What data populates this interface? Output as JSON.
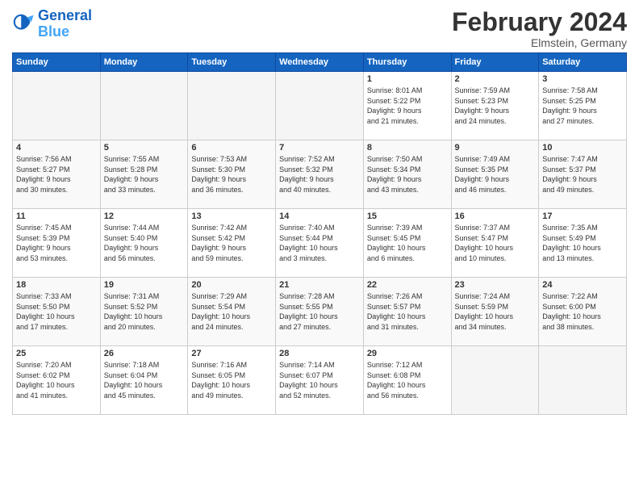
{
  "logo": {
    "line1": "General",
    "line2": "Blue"
  },
  "title": "February 2024",
  "location": "Elmstein, Germany",
  "days_of_week": [
    "Sunday",
    "Monday",
    "Tuesday",
    "Wednesday",
    "Thursday",
    "Friday",
    "Saturday"
  ],
  "weeks": [
    [
      {
        "day": "",
        "info": ""
      },
      {
        "day": "",
        "info": ""
      },
      {
        "day": "",
        "info": ""
      },
      {
        "day": "",
        "info": ""
      },
      {
        "day": "1",
        "info": "Sunrise: 8:01 AM\nSunset: 5:22 PM\nDaylight: 9 hours\nand 21 minutes."
      },
      {
        "day": "2",
        "info": "Sunrise: 7:59 AM\nSunset: 5:23 PM\nDaylight: 9 hours\nand 24 minutes."
      },
      {
        "day": "3",
        "info": "Sunrise: 7:58 AM\nSunset: 5:25 PM\nDaylight: 9 hours\nand 27 minutes."
      }
    ],
    [
      {
        "day": "4",
        "info": "Sunrise: 7:56 AM\nSunset: 5:27 PM\nDaylight: 9 hours\nand 30 minutes."
      },
      {
        "day": "5",
        "info": "Sunrise: 7:55 AM\nSunset: 5:28 PM\nDaylight: 9 hours\nand 33 minutes."
      },
      {
        "day": "6",
        "info": "Sunrise: 7:53 AM\nSunset: 5:30 PM\nDaylight: 9 hours\nand 36 minutes."
      },
      {
        "day": "7",
        "info": "Sunrise: 7:52 AM\nSunset: 5:32 PM\nDaylight: 9 hours\nand 40 minutes."
      },
      {
        "day": "8",
        "info": "Sunrise: 7:50 AM\nSunset: 5:34 PM\nDaylight: 9 hours\nand 43 minutes."
      },
      {
        "day": "9",
        "info": "Sunrise: 7:49 AM\nSunset: 5:35 PM\nDaylight: 9 hours\nand 46 minutes."
      },
      {
        "day": "10",
        "info": "Sunrise: 7:47 AM\nSunset: 5:37 PM\nDaylight: 9 hours\nand 49 minutes."
      }
    ],
    [
      {
        "day": "11",
        "info": "Sunrise: 7:45 AM\nSunset: 5:39 PM\nDaylight: 9 hours\nand 53 minutes."
      },
      {
        "day": "12",
        "info": "Sunrise: 7:44 AM\nSunset: 5:40 PM\nDaylight: 9 hours\nand 56 minutes."
      },
      {
        "day": "13",
        "info": "Sunrise: 7:42 AM\nSunset: 5:42 PM\nDaylight: 9 hours\nand 59 minutes."
      },
      {
        "day": "14",
        "info": "Sunrise: 7:40 AM\nSunset: 5:44 PM\nDaylight: 10 hours\nand 3 minutes."
      },
      {
        "day": "15",
        "info": "Sunrise: 7:39 AM\nSunset: 5:45 PM\nDaylight: 10 hours\nand 6 minutes."
      },
      {
        "day": "16",
        "info": "Sunrise: 7:37 AM\nSunset: 5:47 PM\nDaylight: 10 hours\nand 10 minutes."
      },
      {
        "day": "17",
        "info": "Sunrise: 7:35 AM\nSunset: 5:49 PM\nDaylight: 10 hours\nand 13 minutes."
      }
    ],
    [
      {
        "day": "18",
        "info": "Sunrise: 7:33 AM\nSunset: 5:50 PM\nDaylight: 10 hours\nand 17 minutes."
      },
      {
        "day": "19",
        "info": "Sunrise: 7:31 AM\nSunset: 5:52 PM\nDaylight: 10 hours\nand 20 minutes."
      },
      {
        "day": "20",
        "info": "Sunrise: 7:29 AM\nSunset: 5:54 PM\nDaylight: 10 hours\nand 24 minutes."
      },
      {
        "day": "21",
        "info": "Sunrise: 7:28 AM\nSunset: 5:55 PM\nDaylight: 10 hours\nand 27 minutes."
      },
      {
        "day": "22",
        "info": "Sunrise: 7:26 AM\nSunset: 5:57 PM\nDaylight: 10 hours\nand 31 minutes."
      },
      {
        "day": "23",
        "info": "Sunrise: 7:24 AM\nSunset: 5:59 PM\nDaylight: 10 hours\nand 34 minutes."
      },
      {
        "day": "24",
        "info": "Sunrise: 7:22 AM\nSunset: 6:00 PM\nDaylight: 10 hours\nand 38 minutes."
      }
    ],
    [
      {
        "day": "25",
        "info": "Sunrise: 7:20 AM\nSunset: 6:02 PM\nDaylight: 10 hours\nand 41 minutes."
      },
      {
        "day": "26",
        "info": "Sunrise: 7:18 AM\nSunset: 6:04 PM\nDaylight: 10 hours\nand 45 minutes."
      },
      {
        "day": "27",
        "info": "Sunrise: 7:16 AM\nSunset: 6:05 PM\nDaylight: 10 hours\nand 49 minutes."
      },
      {
        "day": "28",
        "info": "Sunrise: 7:14 AM\nSunset: 6:07 PM\nDaylight: 10 hours\nand 52 minutes."
      },
      {
        "day": "29",
        "info": "Sunrise: 7:12 AM\nSunset: 6:08 PM\nDaylight: 10 hours\nand 56 minutes."
      },
      {
        "day": "",
        "info": ""
      },
      {
        "day": "",
        "info": ""
      }
    ]
  ]
}
